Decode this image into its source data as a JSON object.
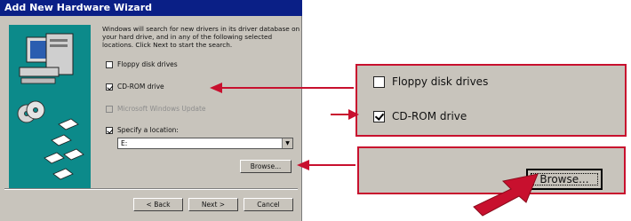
{
  "window": {
    "title": "Add New Hardware Wizard"
  },
  "intro_text": "Windows will search for new drivers in its driver database on your hard drive, and in any of the following selected locations. Click Next to start the search.",
  "options": [
    {
      "label": "Floppy disk drives",
      "checked": false,
      "disabled": false
    },
    {
      "label": "CD-ROM drive",
      "checked": true,
      "disabled": false
    },
    {
      "label": "Microsoft Windows Update",
      "checked": false,
      "disabled": true
    },
    {
      "label": "Specify a location:",
      "checked": true,
      "disabled": false
    }
  ],
  "location": {
    "value": "E:"
  },
  "buttons": {
    "browse": "Browse...",
    "back": "< Back",
    "next": "Next >",
    "cancel": "Cancel"
  },
  "zoom": {
    "floppy_label": "Floppy disk drives",
    "cdrom_label": "CD-ROM drive",
    "browse_label": "Browse..."
  },
  "colors": {
    "title_bar": "#0a1f86",
    "dialog_bg": "#c8c4bc",
    "highlight": "#c8102e",
    "art_bg": "#0c8a8a"
  }
}
